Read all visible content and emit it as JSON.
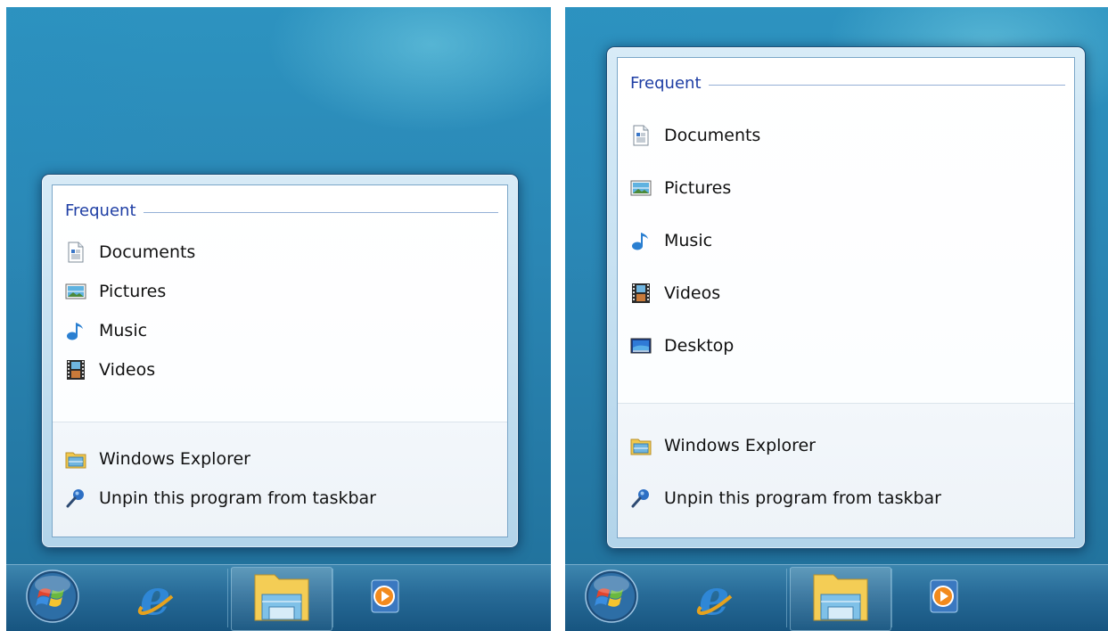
{
  "panels": [
    {
      "jumplist": {
        "section_title": "Frequent",
        "items": [
          {
            "label": "Documents",
            "icon": "documents-icon"
          },
          {
            "label": "Pictures",
            "icon": "pictures-icon"
          },
          {
            "label": "Music",
            "icon": "music-icon"
          },
          {
            "label": "Videos",
            "icon": "videos-icon"
          }
        ],
        "tasks": [
          {
            "label": "Windows Explorer",
            "icon": "windows-explorer-icon"
          },
          {
            "label": "Unpin this program from taskbar",
            "icon": "unpin-icon"
          }
        ]
      },
      "taskbar": [
        "start-orb-icon",
        "internet-explorer-icon",
        "windows-explorer-icon",
        "media-player-icon"
      ]
    },
    {
      "jumplist": {
        "section_title": "Frequent",
        "items": [
          {
            "label": "Documents",
            "icon": "documents-icon"
          },
          {
            "label": "Pictures",
            "icon": "pictures-icon"
          },
          {
            "label": "Music",
            "icon": "music-icon"
          },
          {
            "label": "Videos",
            "icon": "videos-icon"
          },
          {
            "label": "Desktop",
            "icon": "desktop-icon"
          }
        ],
        "tasks": [
          {
            "label": "Windows Explorer",
            "icon": "windows-explorer-icon"
          },
          {
            "label": "Unpin this program from taskbar",
            "icon": "unpin-icon"
          }
        ]
      },
      "taskbar": [
        "start-orb-icon",
        "internet-explorer-icon",
        "windows-explorer-icon",
        "media-player-icon"
      ]
    }
  ],
  "colors": {
    "section_title": "#1e3ea4",
    "desktop_top": "#2d93c0",
    "taskbar": "#1f5f8f"
  }
}
